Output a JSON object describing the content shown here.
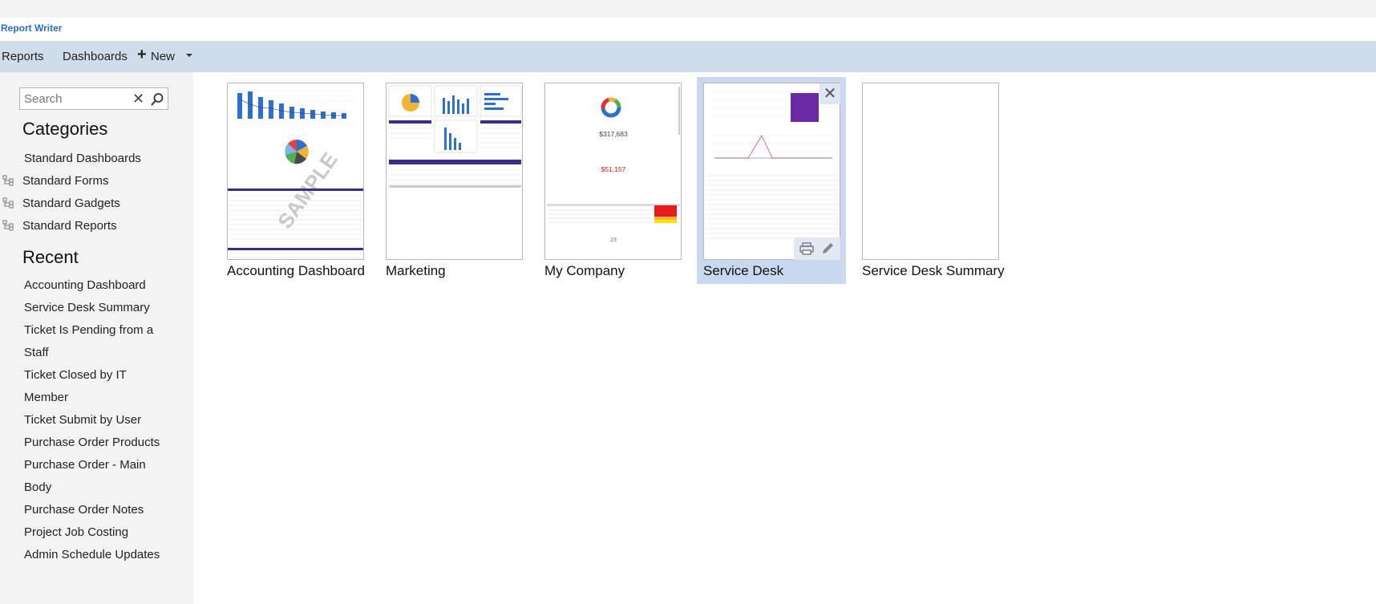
{
  "app": {
    "title": "Report Writer"
  },
  "nav": {
    "reports": "Reports",
    "dashboards": "Dashboards",
    "new": "New"
  },
  "search": {
    "placeholder": "Search"
  },
  "categories": {
    "title": "Categories",
    "items": [
      "Standard Dashboards",
      "Standard Forms",
      "Standard Gadgets",
      "Standard Reports"
    ]
  },
  "recent": {
    "title": "Recent",
    "items": [
      "Accounting Dashboard",
      "Service Desk Summary",
      "Ticket Is Pending from a Staff",
      "Ticket Closed by IT Member",
      "Ticket Submit by User",
      "Purchase Order Products",
      "Purchase Order - Main Body",
      "Purchase Order Notes",
      "Project Job Costing",
      "Admin Schedule Updates"
    ]
  },
  "dashboards": [
    {
      "name": "Accounting Dashboard",
      "watermark": "SAMPLE"
    },
    {
      "name": "Marketing"
    },
    {
      "name": "My Company",
      "kpi1": "$317,683",
      "kpi2": "$51,157",
      "kpi3": "23"
    },
    {
      "name": "Service Desk",
      "selected": true
    },
    {
      "name": "Service Desk Summary"
    }
  ],
  "colors": {
    "navbar": "#cfdcea",
    "accent": "#2a6fbb",
    "selected_tile": "#c9d8ef",
    "purple_block": "#6a2aa6"
  }
}
